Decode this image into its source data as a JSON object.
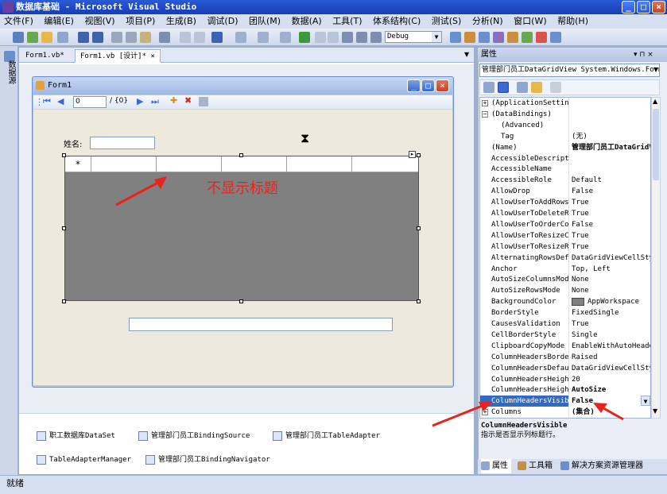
{
  "window": {
    "title": "数据库基础 - Microsoft Visual Studio"
  },
  "menu": [
    "文件(F)",
    "编辑(E)",
    "视图(V)",
    "项目(P)",
    "生成(B)",
    "调试(D)",
    "团队(M)",
    "数据(A)",
    "工具(T)",
    "体系结构(C)",
    "测试(S)",
    "分析(N)",
    "窗口(W)",
    "帮助(H)"
  ],
  "toolbar": {
    "config": "Debug"
  },
  "left_strip": {
    "label": "数据源"
  },
  "tabs": [
    "Form1.vb*",
    "Form1.vb [设计]*"
  ],
  "form": {
    "title": "Form1",
    "nav": {
      "position": "0",
      "count": "/ {0}"
    },
    "name_label": "姓名:",
    "grid_row_marker": "*",
    "annotation": "不显示标题"
  },
  "tray": [
    "职工数据库DataSet",
    "管理部门员工BindingSource",
    "管理部门员工TableAdapter",
    "TableAdapterManager",
    "管理部门员工BindingNavigator"
  ],
  "properties": {
    "header": "属性",
    "pin": "▾ ⊓ ×",
    "object": "管理部门员工DataGridView System.Windows.Forms.DataGridView",
    "rows": [
      {
        "name": "(ApplicationSettings)",
        "value": "",
        "expander": "+"
      },
      {
        "name": "(DataBindings)",
        "value": "",
        "expander": "−"
      },
      {
        "name": "(Advanced)",
        "value": "",
        "indent": true
      },
      {
        "name": "Tag",
        "value": "(无)",
        "indent": true
      },
      {
        "name": "(Name)",
        "value": "管理部门员工DataGridView",
        "bold": true
      },
      {
        "name": "AccessibleDescription",
        "value": ""
      },
      {
        "name": "AccessibleName",
        "value": ""
      },
      {
        "name": "AccessibleRole",
        "value": "Default"
      },
      {
        "name": "AllowDrop",
        "value": "False"
      },
      {
        "name": "AllowUserToAddRows",
        "value": "True"
      },
      {
        "name": "AllowUserToDeleteRows",
        "value": "True"
      },
      {
        "name": "AllowUserToOrderColumns",
        "value": "False"
      },
      {
        "name": "AllowUserToResizeColumns",
        "value": "True"
      },
      {
        "name": "AllowUserToResizeRows",
        "value": "True"
      },
      {
        "name": "AlternatingRowsDefaultCellStyle",
        "value": "DataGridViewCellStyle {}"
      },
      {
        "name": "Anchor",
        "value": "Top, Left"
      },
      {
        "name": "AutoSizeColumnsMode",
        "value": "None"
      },
      {
        "name": "AutoSizeRowsMode",
        "value": "None"
      },
      {
        "name": "BackgroundColor",
        "value": "AppWorkspace",
        "swatch": "#808080"
      },
      {
        "name": "BorderStyle",
        "value": "FixedSingle"
      },
      {
        "name": "CausesValidation",
        "value": "True"
      },
      {
        "name": "CellBorderStyle",
        "value": "Single"
      },
      {
        "name": "ClipboardCopyMode",
        "value": "EnableWithAutoHeaderText"
      },
      {
        "name": "ColumnHeadersBorderStyle",
        "value": "Raised"
      },
      {
        "name": "ColumnHeadersDefaultCellStyle",
        "value": "DataGridViewCellStyle {}"
      },
      {
        "name": "ColumnHeadersHeight",
        "value": "20"
      },
      {
        "name": "ColumnHeadersHeightSizeMode",
        "value": "AutoSize",
        "bold": true
      },
      {
        "name": "ColumnHeadersVisible",
        "value": "False",
        "bold": true,
        "selected": true
      },
      {
        "name": "Columns",
        "value": "(集合)",
        "bold": true,
        "expander": "+"
      }
    ],
    "desc_title": "ColumnHeadersVisible",
    "desc_text": "指示是否显示列标题行。",
    "tabs": [
      "属性",
      "工具箱",
      "解决方案资源管理器"
    ]
  },
  "status": "就绪"
}
